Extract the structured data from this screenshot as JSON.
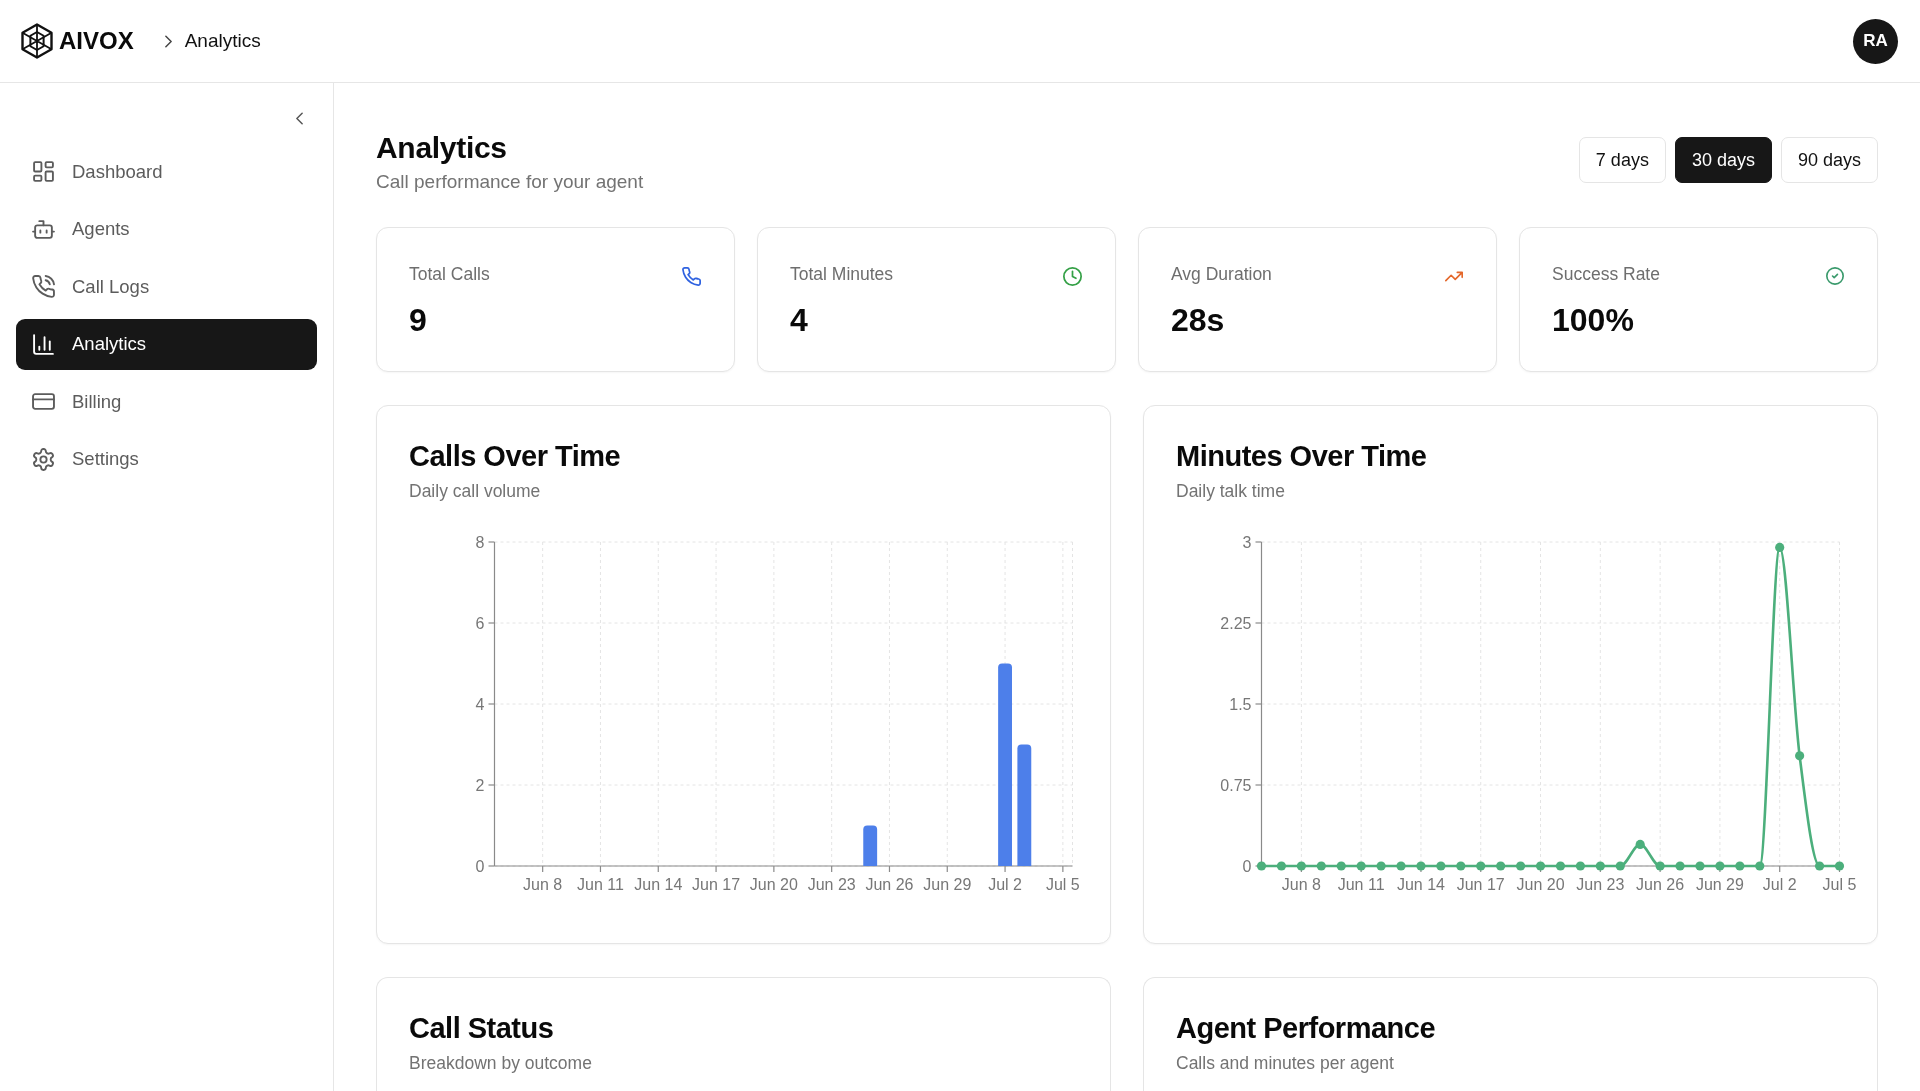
{
  "header": {
    "brand": "AIVOX",
    "breadcrumb": "Analytics",
    "avatar": "RA"
  },
  "sidebar": {
    "items": [
      {
        "label": "Dashboard",
        "selected": false
      },
      {
        "label": "Agents",
        "selected": false
      },
      {
        "label": "Call Logs",
        "selected": false
      },
      {
        "label": "Analytics",
        "selected": true
      },
      {
        "label": "Billing",
        "selected": false
      },
      {
        "label": "Settings",
        "selected": false
      }
    ]
  },
  "page": {
    "title": "Analytics",
    "subtitle": "Call performance for your agent",
    "ranges": [
      {
        "label": "7 days",
        "selected": false
      },
      {
        "label": "30 days",
        "selected": true
      },
      {
        "label": "90 days",
        "selected": false
      }
    ]
  },
  "stats": [
    {
      "label": "Total Calls",
      "value": "9",
      "color": "#2f62e0"
    },
    {
      "label": "Total Minutes",
      "value": "4",
      "color": "#34a046"
    },
    {
      "label": "Avg Duration",
      "value": "28s",
      "color": "#e4672a"
    },
    {
      "label": "Success Rate",
      "value": "100%",
      "color": "#3a9a6c"
    }
  ],
  "charts": [
    {
      "title": "Calls Over Time",
      "subtitle": "Daily call volume",
      "chart_data": {
        "type": "bar",
        "categories": [
          null,
          null,
          "Jun 8",
          null,
          null,
          "Jun 11",
          null,
          null,
          "Jun 14",
          null,
          null,
          "Jun 17",
          null,
          null,
          "Jun 20",
          null,
          null,
          "Jun 23",
          null,
          null,
          "Jun 26",
          null,
          null,
          "Jun 29",
          null,
          null,
          "Jul 2",
          null,
          null,
          "Jul 5"
        ],
        "series": [
          {
            "color": "#4d7fea",
            "values": [
              0,
              0,
              0,
              0,
              0,
              0,
              0,
              0,
              0,
              0,
              0,
              0,
              0,
              0,
              0,
              0,
              0,
              0,
              0,
              1,
              0,
              0,
              0,
              0,
              0,
              0,
              5,
              3,
              0,
              0
            ]
          }
        ],
        "ylim": [
          0,
          8
        ],
        "yticks": [
          0,
          2,
          4,
          6,
          8
        ],
        "grid": true
      }
    },
    {
      "title": "Minutes Over Time",
      "subtitle": "Daily talk time",
      "chart_data": {
        "type": "line",
        "categories": [
          null,
          null,
          "Jun 8",
          null,
          null,
          "Jun 11",
          null,
          null,
          "Jun 14",
          null,
          null,
          "Jun 17",
          null,
          null,
          "Jun 20",
          null,
          null,
          "Jun 23",
          null,
          null,
          "Jun 26",
          null,
          null,
          "Jun 29",
          null,
          null,
          "Jul 2",
          null,
          null,
          "Jul 5"
        ],
        "series": [
          {
            "color": "#4caf7c",
            "marker": true,
            "values": [
              0,
              0,
              0,
              0,
              0,
              0,
              0,
              0,
              0,
              0,
              0,
              0,
              0,
              0,
              0,
              0,
              0,
              0,
              0,
              0.2,
              0,
              0,
              0,
              0,
              0,
              0,
              2.95,
              1.02,
              0,
              0
            ]
          }
        ],
        "ylim": [
          0,
          3
        ],
        "yticks": [
          0,
          0.75,
          1.5,
          2.25,
          3
        ],
        "grid": true
      }
    }
  ],
  "panels": [
    {
      "title": "Call Status",
      "subtitle": "Breakdown by outcome"
    },
    {
      "title": "Agent Performance",
      "subtitle": "Calls and minutes per agent"
    }
  ]
}
